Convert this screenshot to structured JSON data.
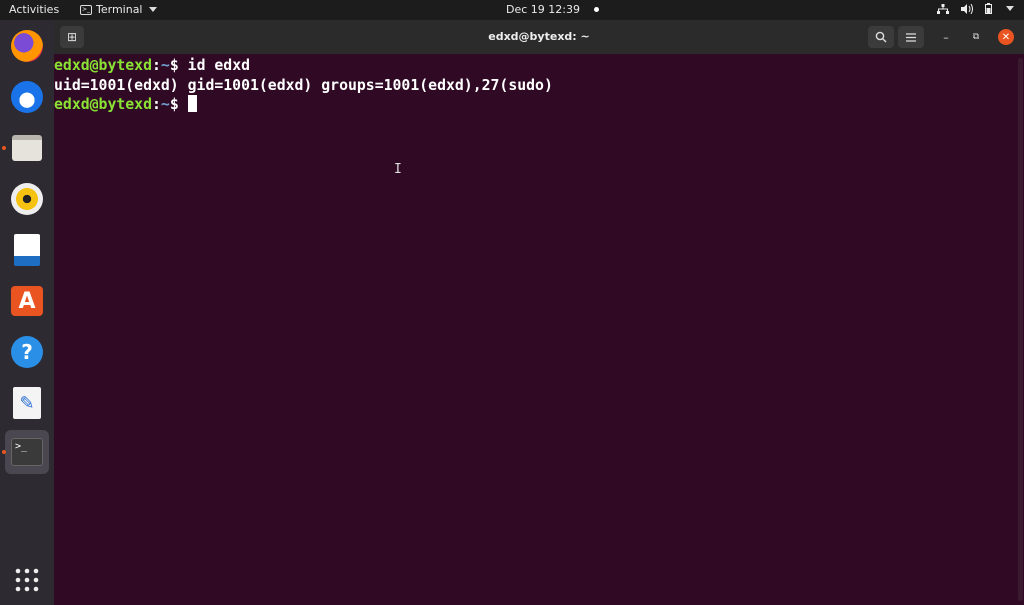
{
  "topbar": {
    "activities_label": "Activities",
    "app_name": "Terminal",
    "clock": "Dec 19  12:39"
  },
  "dock": {
    "apps": [
      {
        "name": "Firefox",
        "icon": "firefox-icon",
        "running": false
      },
      {
        "name": "Thunderbird",
        "icon": "thunderbird-icon",
        "running": false
      },
      {
        "name": "Files",
        "icon": "files-icon",
        "running": true
      },
      {
        "name": "Rhythmbox",
        "icon": "rhythmbox-icon",
        "running": false
      },
      {
        "name": "LibreOffice Writer",
        "icon": "writer-icon",
        "running": false
      },
      {
        "name": "Ubuntu Software",
        "icon": "software-icon",
        "running": false
      },
      {
        "name": "Help",
        "icon": "help-icon",
        "running": false
      },
      {
        "name": "Text Editor",
        "icon": "text-editor-icon",
        "running": false
      },
      {
        "name": "Terminal",
        "icon": "terminal-icon",
        "running": true
      }
    ],
    "show_apps_icon": "grid-icon"
  },
  "window": {
    "title": "edxd@bytexd: ~"
  },
  "terminal": {
    "prompt_user": "edxd@bytexd",
    "prompt_sep": ":",
    "prompt_path": "~",
    "prompt_symbol": "$ ",
    "command": "id edxd",
    "output": "uid=1001(edxd) gid=1001(edxd) groups=1001(edxd),27(sudo)"
  },
  "colors": {
    "terminal_bg": "#300a24",
    "prompt_user": "#8ae234",
    "prompt_path": "#729fcf",
    "accent": "#e95420"
  }
}
